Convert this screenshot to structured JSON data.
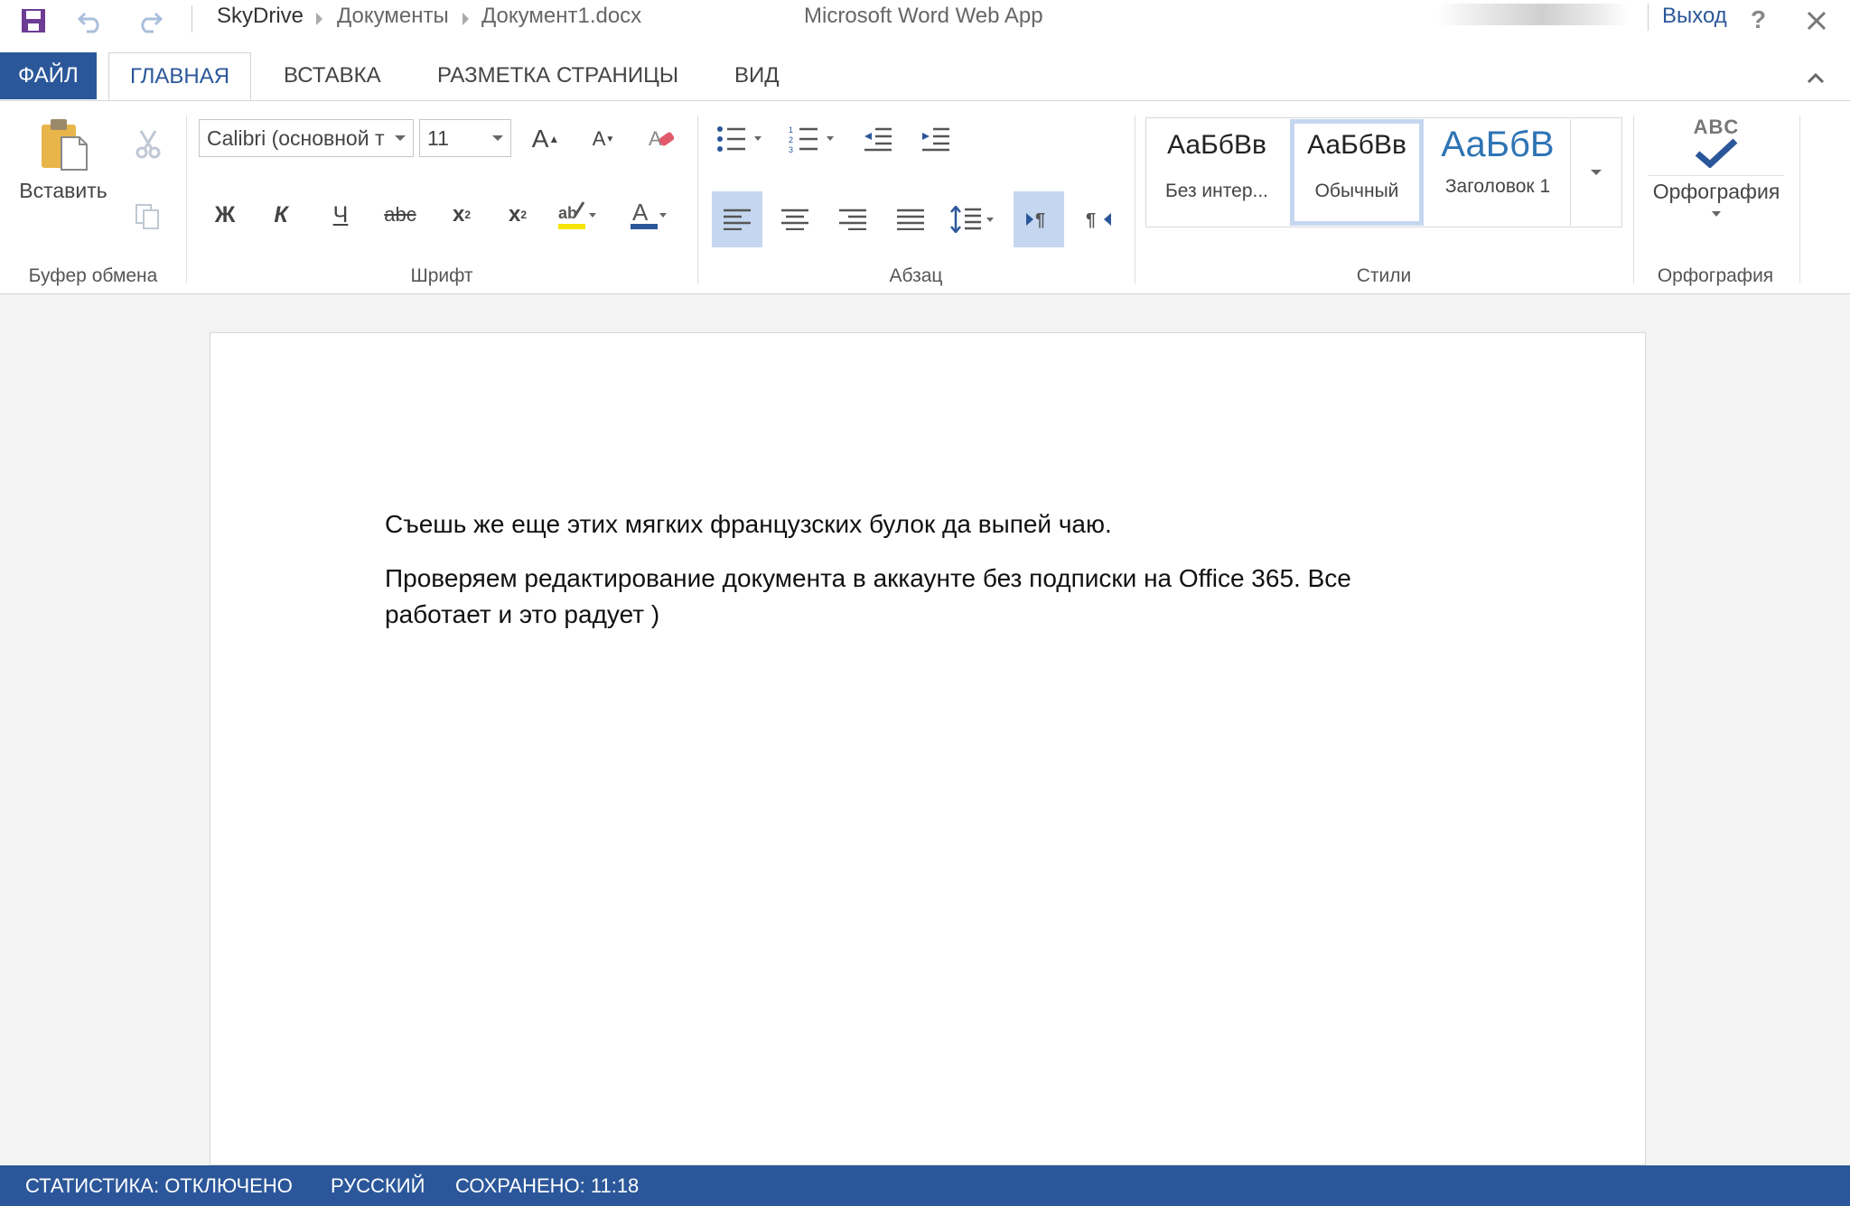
{
  "titlebar": {
    "breadcrumb": [
      "SkyDrive",
      "Документы",
      "Документ1.docx"
    ],
    "app_title": "Microsoft Word Web App",
    "signout": "Выход",
    "help": "?"
  },
  "tabs": {
    "file": "ФАЙЛ",
    "home": "ГЛАВНАЯ",
    "insert": "ВСТАВКА",
    "layout": "РАЗМЕТКА СТРАНИЦЫ",
    "view": "ВИД"
  },
  "ribbon": {
    "clipboard": {
      "paste": "Вставить",
      "label": "Буфер обмена"
    },
    "font": {
      "font_name": "Calibri (основной т",
      "font_size": "11",
      "bold": "Ж",
      "italic": "К",
      "underline": "Ч",
      "strike": "abc",
      "label": "Шрифт"
    },
    "paragraph": {
      "label": "Абзац"
    },
    "styles": {
      "items": [
        {
          "sample": "АаБбВв",
          "name": "Без интер..."
        },
        {
          "sample": "АаБбВв",
          "name": "Обычный"
        },
        {
          "sample": "АаБбВ",
          "name": "Заголовок 1"
        }
      ],
      "label": "Стили"
    },
    "proofing": {
      "abc": "ABC",
      "spelling": "Орфография",
      "label": "Орфография"
    }
  },
  "document": {
    "paragraphs": [
      "Съешь же еще этих мягких французских булок да выпей чаю.",
      "Проверяем редактирование документа в аккаунте без подписки на Office 365. Все",
      "работает и это радует )"
    ]
  },
  "status": {
    "stats": "СТАТИСТИКА: ОТКЛЮЧЕНО",
    "language": "РУССКИЙ",
    "saved": "СОХРАНЕНО: 11:18"
  },
  "colors": {
    "accent": "#2b579a",
    "selected": "#c5d7f0",
    "heading": "#2e74b5",
    "paste_icon": "#e8b54a"
  }
}
